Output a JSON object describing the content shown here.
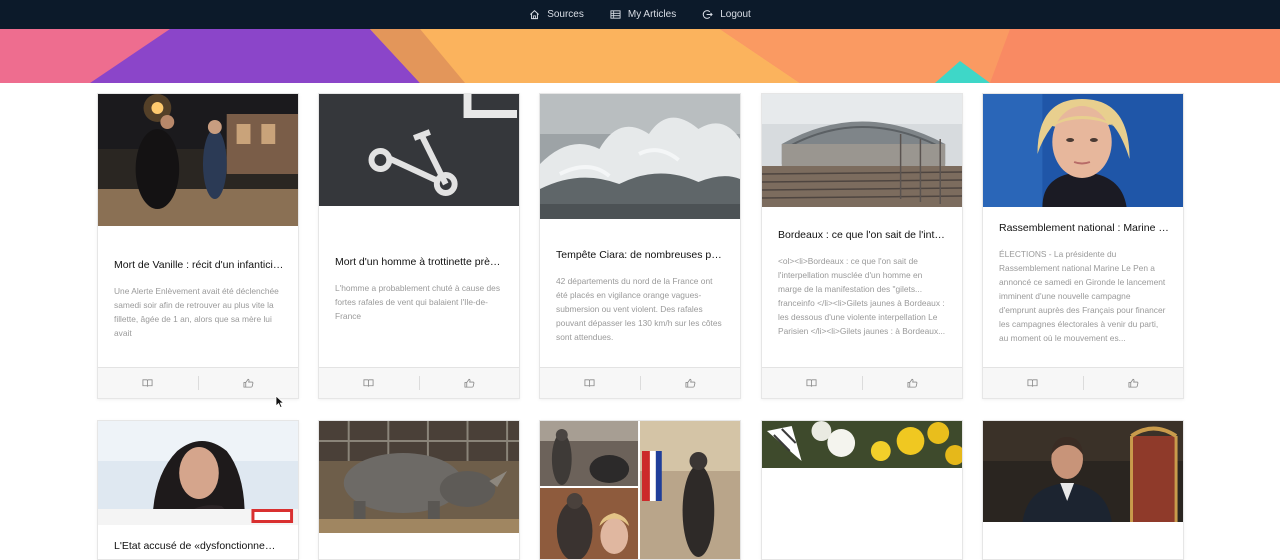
{
  "nav": {
    "items": [
      {
        "label": "Sources",
        "icon": "home-icon"
      },
      {
        "label": "My Articles",
        "icon": "list-icon"
      },
      {
        "label": "Logout",
        "icon": "logout-icon"
      }
    ]
  },
  "colors": {
    "nav_bg": "#0c1a2a",
    "banner_pink": "#ee6d8f",
    "banner_purple": "#8b45c9",
    "banner_orange": "#fbb35d",
    "banner_coral": "#f98a63",
    "banner_teal": "#3ed7c8"
  },
  "cards": [
    {
      "title": "Mort de Vanille : récit d'un infanticide",
      "description": "Une Alerte Enlèvement avait été déclenchée samedi soir afin de retrouver au plus vite la fillette, âgée de 1 an, alors que sa mère lui avait",
      "image": "night-street-photo",
      "actions": [
        "read-icon",
        "like-icon"
      ]
    },
    {
      "title": "Mort d'un homme à trottinette près de Paris",
      "description": "L'homme a probablement chuté à cause des fortes rafales de vent qui balaient l'Ile-de-France",
      "image": "scooter-road-marking-photo",
      "actions": [
        "read-icon",
        "like-icon"
      ]
    },
    {
      "title": "Tempête Ciara: de nombreuses perturbations",
      "description": "42 départements du nord de la France ont été placés en vigilance orange vagues-submersion ou vent violent. Des rafales pouvant dépasser les 130 km/h sur les côtes sont attendues.",
      "image": "storm-waves-photo",
      "actions": [
        "read-icon",
        "like-icon"
      ]
    },
    {
      "title": "Bordeaux : ce que l'on sait de l'interpellation",
      "description": "<ol><li>Bordeaux : ce que l'on sait de l'interpellation musclée d'un homme en marge de la manifestation des \"gilets...  franceinfo </li><li>Gilets jaunes à Bordeaux : les dessous d'une violente interpellation  Le Parisien </li><li>Gilets jaunes : à Bordeaux...",
      "image": "train-station-photo",
      "actions": [
        "read-icon",
        "like-icon"
      ]
    },
    {
      "title": "Rassemblement national : Marine Le Pen",
      "description": "ÉLECTIONS - La présidente du Rassemblement national Marine Le Pen a annoncé ce samedi en Gironde le lancement imminent d'une nouvelle campagne d'emprunt auprès des Français pour financer les campagnes électorales à venir du parti, au moment où le mouvement es...",
      "image": "portrait-photo",
      "actions": [
        "read-icon",
        "like-icon"
      ]
    },
    {
      "title": "L'Etat accusé de «dysfonctionnements»",
      "description": "",
      "image": "woman-portrait-photo",
      "actions": []
    },
    {
      "title": "",
      "description": "",
      "image": "rhinoceros-photo",
      "actions": []
    },
    {
      "title": "",
      "description": "",
      "image": "statue-collage-photo",
      "actions": []
    },
    {
      "title": "",
      "description": "",
      "image": "flowers-photo",
      "actions": []
    },
    {
      "title": "",
      "description": "",
      "image": "man-in-suit-photo",
      "actions": []
    }
  ]
}
